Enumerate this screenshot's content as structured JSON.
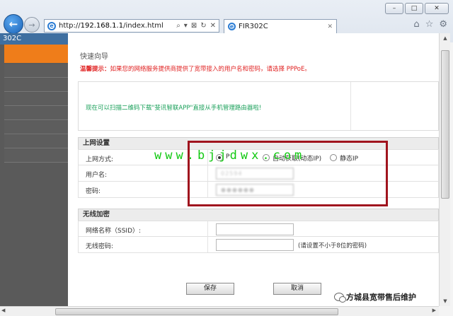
{
  "browser": {
    "url_prefix": "http://",
    "url_host": "192.168.1.1",
    "url_path": "/index.html",
    "tab_title": "FIR302C",
    "addr_tools": [
      "⌕",
      "▾",
      "⊠",
      "↻",
      "✕"
    ],
    "tools_icons": [
      "home-icon",
      "star-icon",
      "gear-icon"
    ]
  },
  "sidebar": {
    "title": "302C",
    "accent_color": "#ef7d1a"
  },
  "wizard": {
    "title": "快速向导",
    "hint_label": "温馨提示：",
    "hint_text": "如果您的网络服务提供商提供了宽带接入的用户名和密码，请选择",
    "hint_pppoe": "PPPoE。",
    "app_text": "现在可以扫描二维码下载\"斐讯智联APP\"直接从手机管理路由器啦!"
  },
  "internet": {
    "section_title": "上网设置",
    "method_label": "上网方式:",
    "option_pppoe": "P",
    "option_dhcp": "自动获取(动态IP)",
    "option_static": "静态IP",
    "username_label": "用户名:",
    "username_value": "02594",
    "password_label": "密码:",
    "password_value": "●●●●●●"
  },
  "wireless": {
    "section_title": "无线加密",
    "ssid_label": "网络名称（SSID）:",
    "ssid_value": "",
    "password_label": "无线密码:",
    "password_value": "",
    "password_hint": "(请设置不小于8位的密码)"
  },
  "actions": {
    "save": "保存",
    "cancel": "取消"
  },
  "overlay": {
    "watermark": "www.bjjdwx.com",
    "credit": "方城县宽带售后维护"
  }
}
